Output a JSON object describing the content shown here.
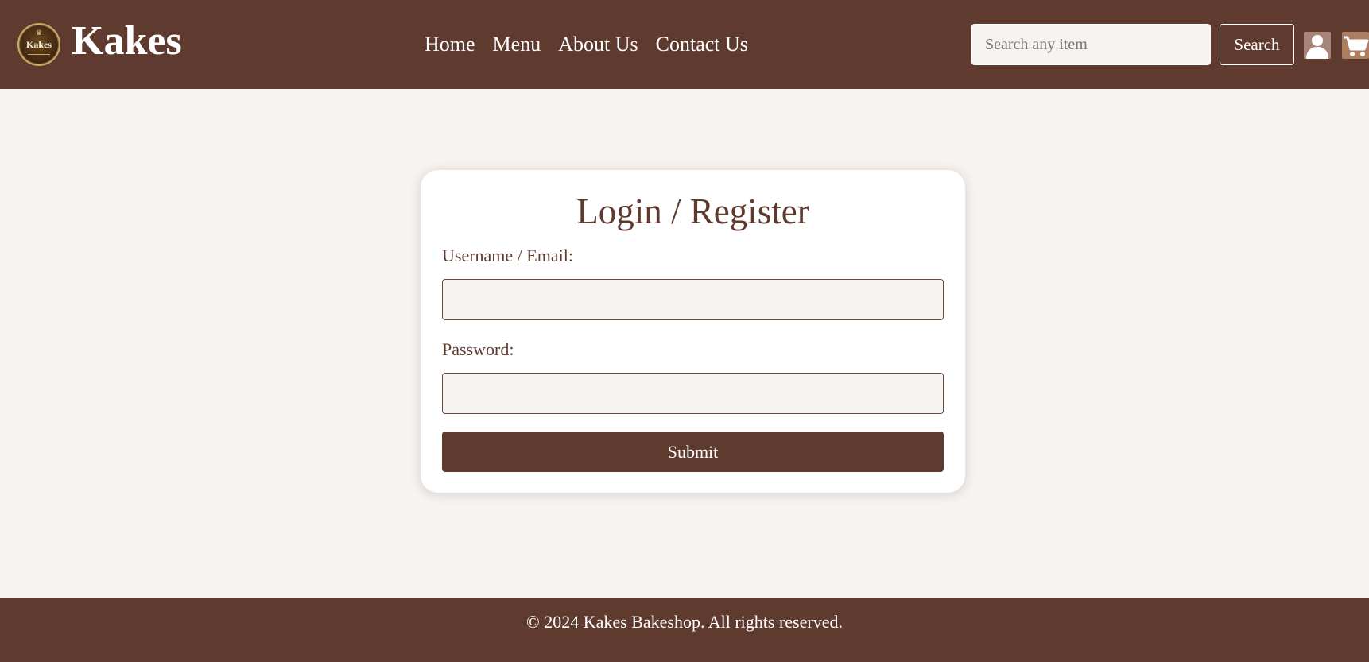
{
  "header": {
    "logo": {
      "text": "Kakes",
      "icon": "kakes-logo-badge"
    },
    "brand": "Kakes",
    "nav": [
      {
        "label": "Home"
      },
      {
        "label": "Menu"
      },
      {
        "label": "About Us"
      },
      {
        "label": "Contact Us"
      }
    ],
    "search": {
      "placeholder": "Search any item",
      "value": "",
      "button_label": "Search"
    },
    "icons": {
      "user": "user-icon",
      "cart": "cart-icon"
    }
  },
  "login": {
    "title": "Login / Register",
    "username_label": "Username / Email:",
    "username_value": "",
    "password_label": "Password:",
    "password_value": "",
    "submit_label": "Submit"
  },
  "footer": {
    "text": "© 2024 Kakes Bakeshop. All rights reserved."
  },
  "colors": {
    "brand_brown": "#5f3a2e",
    "page_background": "#f7f3f0",
    "card_background": "#ffffff",
    "text_light": "#ffffff"
  }
}
